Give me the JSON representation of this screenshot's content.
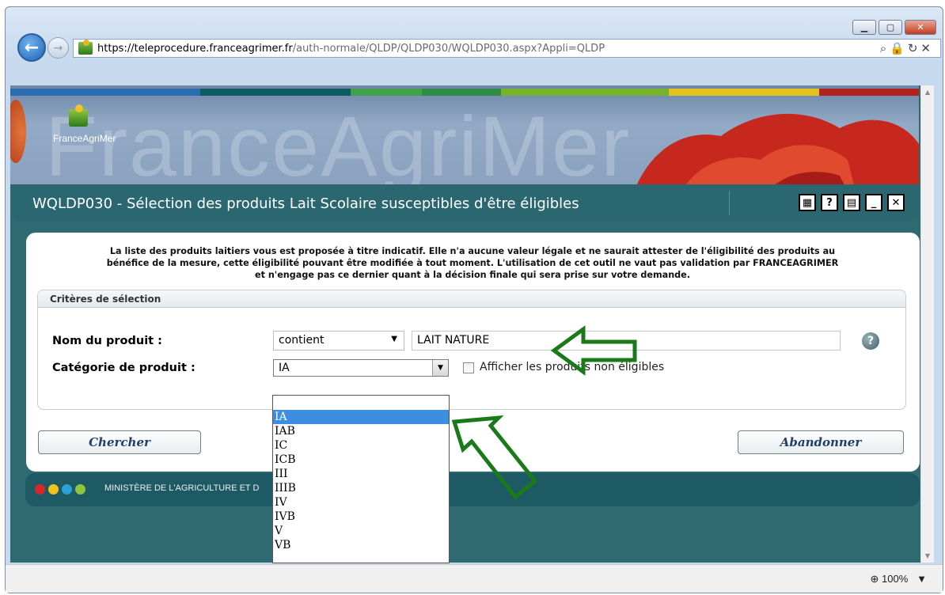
{
  "browser": {
    "url_host": "https://teleprocedure.franceagrimer.fr",
    "url_path": "/auth-normale/QLDP/QLDP030/WQLDP030.aspx?Appli=QLDP",
    "zoom": "100%",
    "back_icon": "back-arrow-icon",
    "forward_icon": "forward-arrow-icon"
  },
  "banner": {
    "logo_text": "FranceAgriMer",
    "watermark": "FranceAgriMer",
    "colors": [
      "#2a6cae",
      "#0e5a60",
      "#3fa148",
      "#2f8b45",
      "#75b42a",
      "#e3c21c",
      "#b3211e"
    ]
  },
  "title": {
    "text": "WQLDP030 - Sélection des produits Lait Scolaire susceptibles d'être éligibles",
    "icons": [
      "calculator-icon",
      "help-icon",
      "print-icon",
      "minimize-icon",
      "close-icon"
    ]
  },
  "disclaimer": {
    "line1": "La liste des produits laitiers vous est proposée à titre indicatif. Elle n'a aucune valeur légale et ne saurait attester de l'éligibilité des produits au",
    "line2": "bénéfice de la mesure, cette éligibilité pouvant être modifiée à tout moment. L'utilisation de cet outil ne vaut pas validation par FRANCEAGRIMER",
    "line3": "et n'engage pas ce dernier quant à la décision finale qui sera prise sur votre demande."
  },
  "criteria": {
    "header": "Critères de sélection",
    "product_name_label": "Nom du produit :",
    "match_mode": "contient",
    "product_name_value": "LAIT NATURE",
    "category_label": "Catégorie de produit :",
    "category_value": "IA",
    "show_ineligible_label": "Afficher les produits non éligibles",
    "show_ineligible_checked": false
  },
  "buttons": {
    "search": "Chercher",
    "cancel": "Abandonner"
  },
  "footer": {
    "text": "MINISTÈRE DE L'AGRICULTURE ET D",
    "dot_colors": [
      "#d6262a",
      "#f1c21f",
      "#2f9fd8",
      "#8cc63f"
    ]
  },
  "dropdown": {
    "options": [
      "",
      "IA",
      "IAB",
      "IC",
      "ICB",
      "III",
      "IIIB",
      "IV",
      "IVB",
      "V",
      "VB"
    ],
    "selected": "IA"
  },
  "annotation": {
    "arrow_color": "#1a7a1a"
  }
}
